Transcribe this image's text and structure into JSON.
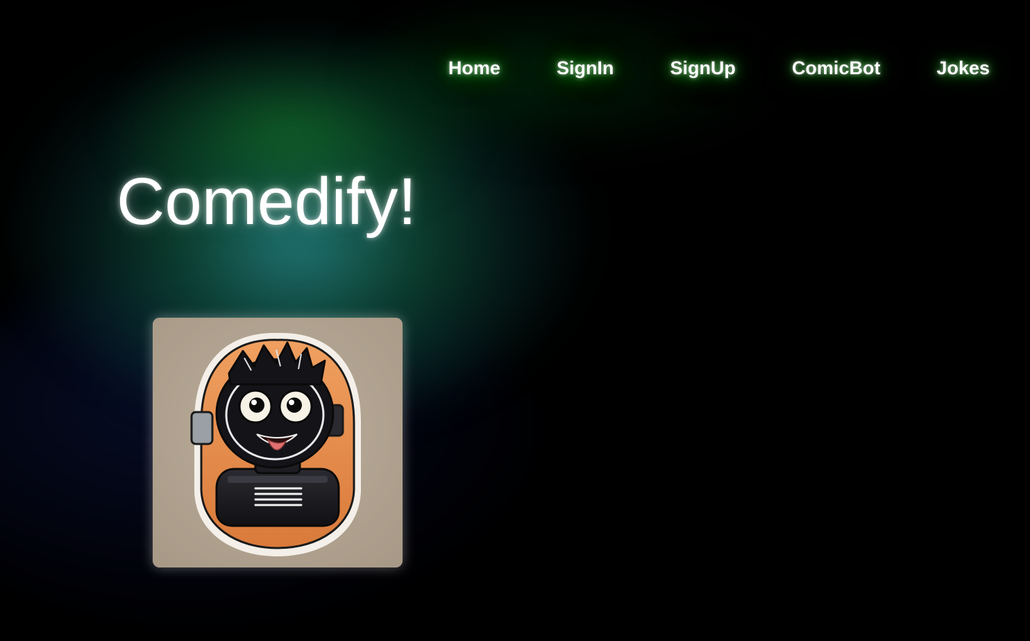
{
  "nav": {
    "items": [
      {
        "label": "Home"
      },
      {
        "label": "SignIn"
      },
      {
        "label": "SignUp"
      },
      {
        "label": "ComicBot"
      },
      {
        "label": "Jokes"
      }
    ]
  },
  "hero": {
    "title": "Comedify!"
  },
  "logo": {
    "icon": "robot-mascot-icon"
  },
  "colors": {
    "background": "#000000",
    "nav_glow": "#2ea043",
    "title_glow": "#2a8c8c",
    "logo_card": "#b4a796",
    "logo_badge": "#e8934a"
  }
}
